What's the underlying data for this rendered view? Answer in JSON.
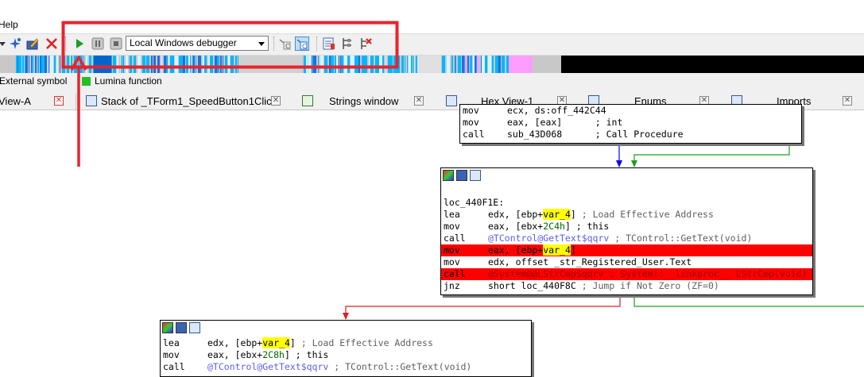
{
  "menu": {
    "help_label": "Help"
  },
  "toolbar": {
    "debugger_select": "Local Windows debugger",
    "colors": {
      "highlight_box": "#e8232e"
    }
  },
  "legend": {
    "external_symbol": "External symbol",
    "lumina_function": "Lumina function",
    "lumina_color": "#22c022"
  },
  "tabs": [
    {
      "label": "View-A"
    },
    {
      "label": "Stack of _TForm1_SpeedButton1Click"
    },
    {
      "label": "Strings window"
    },
    {
      "label": "Hex View-1"
    },
    {
      "label": "Enums"
    },
    {
      "label": "Imports"
    }
  ],
  "block_top": {
    "lines": [
      {
        "mn": "mov",
        "op": "ecx, ds:off_442C44"
      },
      {
        "mn": "mov",
        "op": "eax, [eax]      ; int"
      },
      {
        "mn": "call",
        "op": "sub_43D068      ; Call Procedure"
      }
    ]
  },
  "block_mid": {
    "label": "loc_440F1E:",
    "l1_mn": "lea",
    "l1_a": "edx, [ebp+",
    "l1_var": "var_4",
    "l1_b": "]",
    "l1_c": " ; Load Effective Address",
    "l2_mn": "mov",
    "l2_a": "eax, [ebx+",
    "l2_num": "2C4h",
    "l2_b": "] ; this",
    "l3_mn": "call",
    "l3_fn": "@TControl@GetText$qqrv",
    "l3_c": " ; TControl::GetText(void)",
    "l4_mn": "mov",
    "l4_a": "eax, [ebp+",
    "l4_var": "var_4",
    "l4_b": "]",
    "l5_mn": "mov",
    "l5_a": "edx, offset _str_Registered_User.Text",
    "l6_mn": "call",
    "l6_fn": "@System@@LStrCmp$qqrv",
    "l6_c": " ; System::__linkproc__ LStrCmp(void)",
    "l7_mn": "jnz",
    "l7_a": "short loc_440F8C",
    "l7_c": " ; Jump if Not Zero (ZF=0)"
  },
  "block_bot": {
    "l1_mn": "lea",
    "l1_a": "edx, [ebp+",
    "l1_var": "var_4",
    "l1_b": "]",
    "l1_c": " ; Load Effective Address",
    "l2_mn": "mov",
    "l2_a": "eax, [ebx+",
    "l2_num": "2C8h",
    "l2_b": "] ; this",
    "l3_mn": "call",
    "l3_fn": "@TControl@GetText$qqrv",
    "l3_c": " ; TControl::GetText(void)"
  },
  "icons": {
    "toolbar": [
      "arrow-dropdown-icon",
      "sparkle-icon",
      "edit-icon",
      "close-x-icon",
      "play-icon",
      "pause-icon",
      "stop-icon",
      "step-into-icon",
      "run-to-cursor-icon",
      "breakpoint-list-icon",
      "tracing-icon",
      "clear-trace-icon"
    ]
  }
}
